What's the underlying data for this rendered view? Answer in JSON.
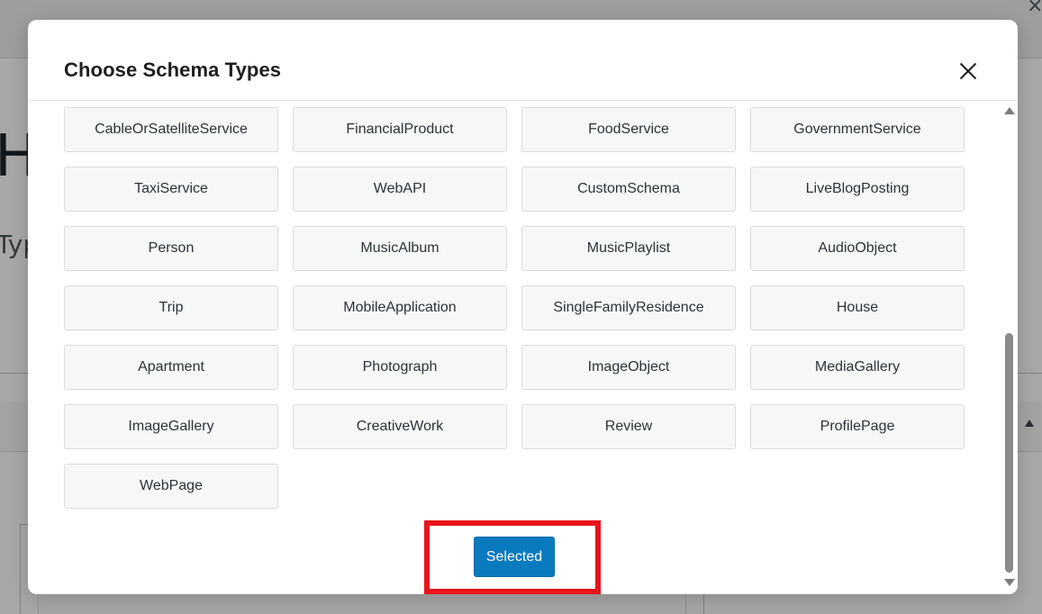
{
  "modal": {
    "title": "Choose Schema Types",
    "close_icon": "close-icon",
    "schema_types": [
      "CableOrSatelliteService",
      "FinancialProduct",
      "FoodService",
      "GovernmentService",
      "TaxiService",
      "WebAPI",
      "CustomSchema",
      "LiveBlogPosting",
      "Person",
      "MusicAlbum",
      "MusicPlaylist",
      "AudioObject",
      "Trip",
      "MobileApplication",
      "SingleFamilyResidence",
      "House",
      "Apartment",
      "Photograph",
      "ImageObject",
      "MediaGallery",
      "ImageGallery",
      "CreativeWork",
      "Review",
      "ProfilePage",
      "WebPage"
    ],
    "selected_button_label": "Selected"
  },
  "colors": {
    "primary_button": "#0a7abf",
    "highlight": "#e8141c",
    "schema_button_bg": "#f6f7f7"
  }
}
